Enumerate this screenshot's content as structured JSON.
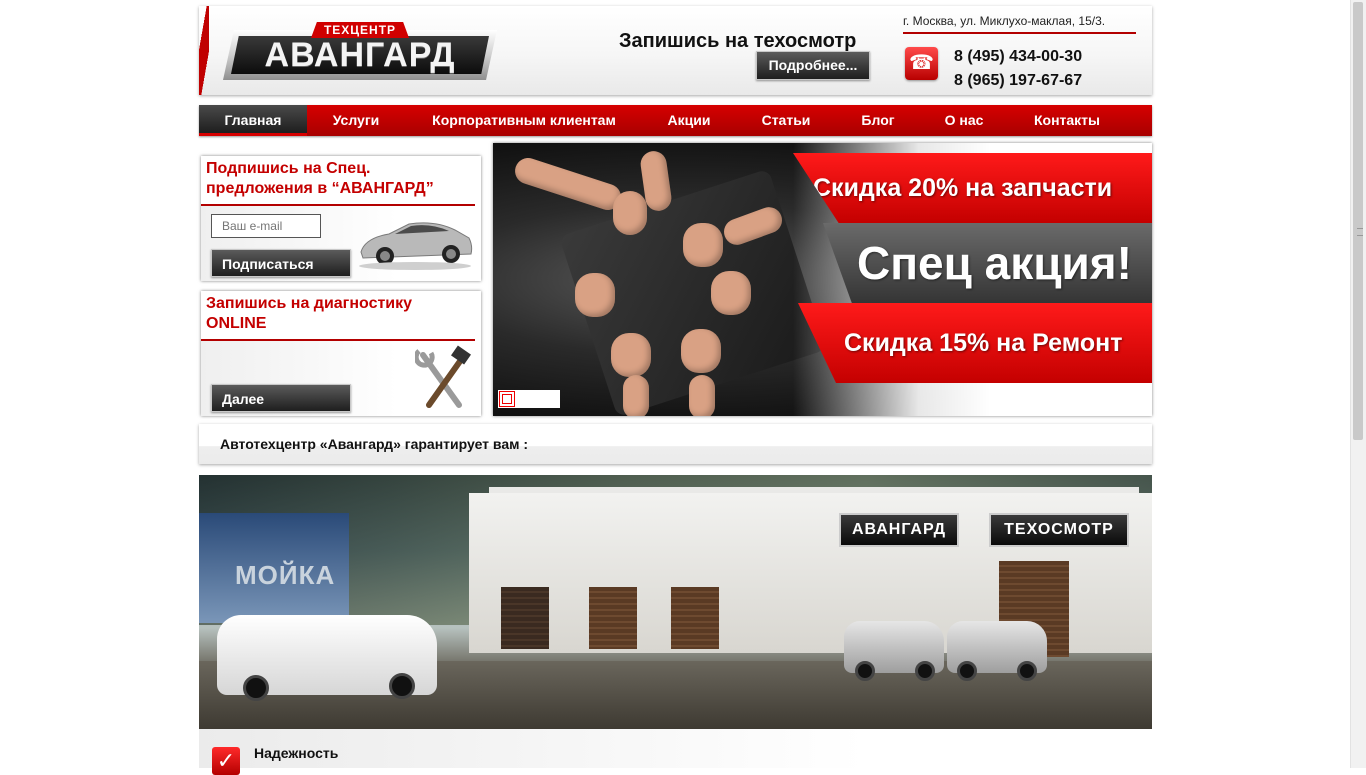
{
  "header": {
    "logo_text": "АВАНГАРД",
    "logo_tag": "ТЕХЦЕНТР",
    "cta_title": "Запишись на техосмотр",
    "cta_button": "Подробнее...",
    "address": "г. Москва, ул. Миклухо-маклая, 15/3.",
    "phone_icon": "☎",
    "phones": [
      "8 (495) 434-00-30",
      "8 (965) 197-67-67"
    ]
  },
  "nav": {
    "items": [
      {
        "label": "Главная",
        "active": true
      },
      {
        "label": "Услуги"
      },
      {
        "label": "Корпоративным клиентам"
      },
      {
        "label": "Акции"
      },
      {
        "label": "Статьи"
      },
      {
        "label": "Блог"
      },
      {
        "label": "О нас"
      },
      {
        "label": "Контакты"
      }
    ]
  },
  "subscribe": {
    "title": "Подпишись на Спец. предложения в “АВАНГАРД”",
    "email_placeholder": "Ваш e-mail",
    "button": "Подписаться"
  },
  "diagnostics": {
    "title": "Запишись на диагностику ONLINE",
    "button": "Далее"
  },
  "slider": {
    "line1": "Скидка 20% на запчасти",
    "line2": "Спец акция!",
    "line3": "Скидка 15% на Ремонт"
  },
  "guarantee": {
    "text": "Автотехцентр «Авангард» гарантирует вам :"
  },
  "photo": {
    "sign_logo": "АВАНГАРД",
    "sign_service": "ТЕХОСМОТР",
    "wash_sign": "МОЙКА"
  },
  "features": {
    "first_title": "Надежность",
    "check_icon": "✓"
  },
  "colors": {
    "brand_red": "#c40000",
    "nav_red": "#d60000",
    "dark": "#1e1e1e"
  }
}
